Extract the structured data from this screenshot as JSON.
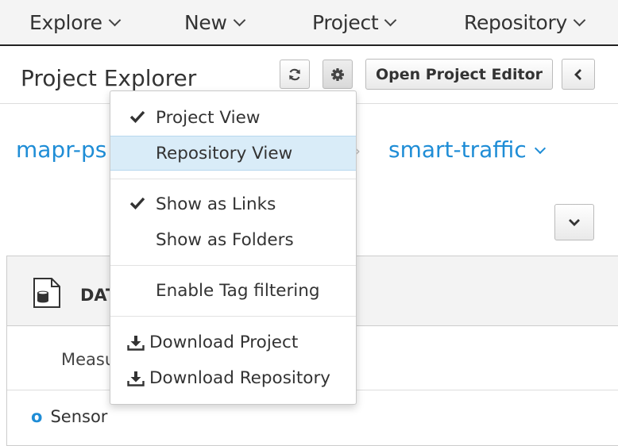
{
  "nav": {
    "items": [
      {
        "label": "Explore"
      },
      {
        "label": "New"
      },
      {
        "label": "Project"
      },
      {
        "label": "Repository"
      }
    ]
  },
  "header": {
    "title": "Project Explorer",
    "open_editor_label": "Open Project Editor",
    "icons": [
      "refresh-icon",
      "gear-icon",
      "chevron-left-icon"
    ]
  },
  "breadcrumb": {
    "owner": "mapr-ps",
    "repo": "smart-traffic",
    "separator": "›"
  },
  "panel": {
    "header_label": "DAT",
    "measu_label": "Measu",
    "sensor_label": "Sensor"
  },
  "menu": {
    "items": [
      {
        "label": "Project View",
        "checked": true
      },
      {
        "label": "Repository View",
        "checked": false,
        "highlighted": true
      },
      {
        "label": "Show as Links",
        "checked": true
      },
      {
        "label": "Show as Folders",
        "checked": false
      },
      {
        "label": "Enable Tag filtering",
        "checked": false
      },
      {
        "label": "Download Project",
        "icon": "download-icon"
      },
      {
        "label": "Download Repository",
        "icon": "download-icon"
      }
    ]
  },
  "colors": {
    "link_blue": "#1f8dd6",
    "highlight": "#d9ecf8",
    "nav_bg": "#f4f4f4"
  }
}
